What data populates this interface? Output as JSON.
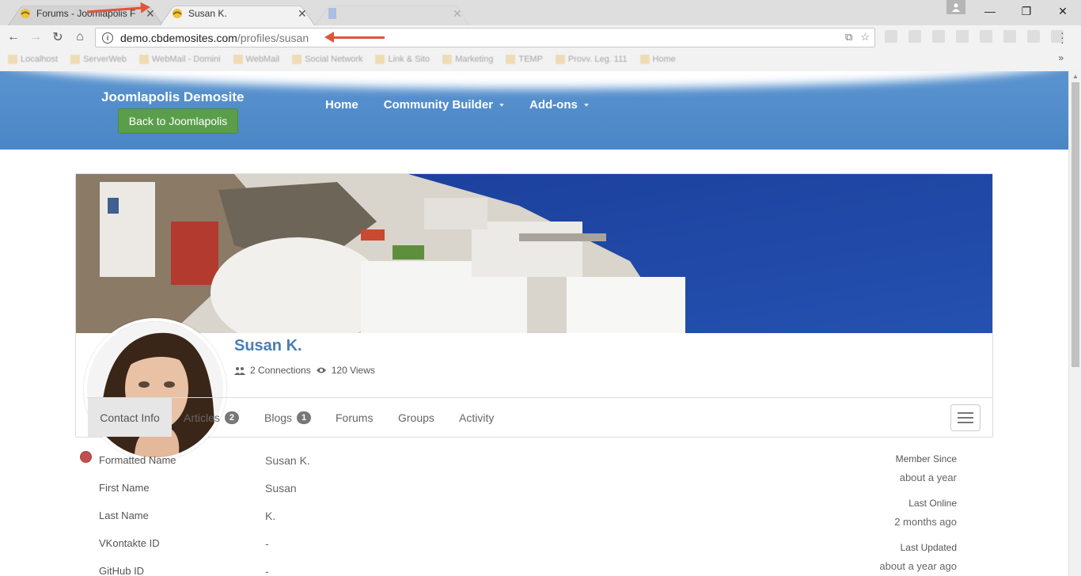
{
  "browser": {
    "tabs": [
      {
        "title": "Forums - Joomlapolis F",
        "favicon": "joomlapolis-favicon"
      },
      {
        "title": "Susan K.",
        "favicon": "joomlapolis-favicon"
      },
      {
        "title": "",
        "favicon": "google-docs-favicon"
      }
    ],
    "url_host": "demo.cbdemosites.com",
    "url_path": "/profiles/susan",
    "bookmarks": [
      "Localhost",
      "ServerWeb",
      "WebMail - Domini",
      "WebMail",
      "Social Network",
      "Link & Sito",
      "Marketing",
      "TEMP",
      "Provv. Leg. 111",
      "Home"
    ]
  },
  "site": {
    "title": "Joomlapolis Demosite",
    "back_button": "Back to Joomlapolis",
    "nav": [
      "Home",
      "Community Builder",
      "Add-ons"
    ]
  },
  "profile": {
    "name": "Susan K.",
    "connections": "2 Connections",
    "views": "120 Views",
    "status_color": "#c0504d",
    "tabs": [
      {
        "label": "Contact Info",
        "badge": ""
      },
      {
        "label": "Articles",
        "badge": "2"
      },
      {
        "label": "Blogs",
        "badge": "1"
      },
      {
        "label": "Forums",
        "badge": ""
      },
      {
        "label": "Groups",
        "badge": ""
      },
      {
        "label": "Activity",
        "badge": ""
      }
    ],
    "fields": [
      {
        "label": "Formatted Name",
        "value": "Susan K."
      },
      {
        "label": "First Name",
        "value": "Susan"
      },
      {
        "label": "Last Name",
        "value": "K."
      },
      {
        "label": "VKontakte ID",
        "value": "-"
      },
      {
        "label": "GitHub ID",
        "value": "-"
      }
    ],
    "meta": [
      {
        "label": "Member Since",
        "value": "about a year"
      },
      {
        "label": "Last Online",
        "value": "2 months ago"
      },
      {
        "label": "Last Updated",
        "value": "about a year ago"
      }
    ]
  },
  "colors": {
    "header_blue": "#4a86c6",
    "back_button_green": "#5a9e4b",
    "name_blue": "#4a7db5",
    "annotation_arrow": "#e0553a"
  }
}
